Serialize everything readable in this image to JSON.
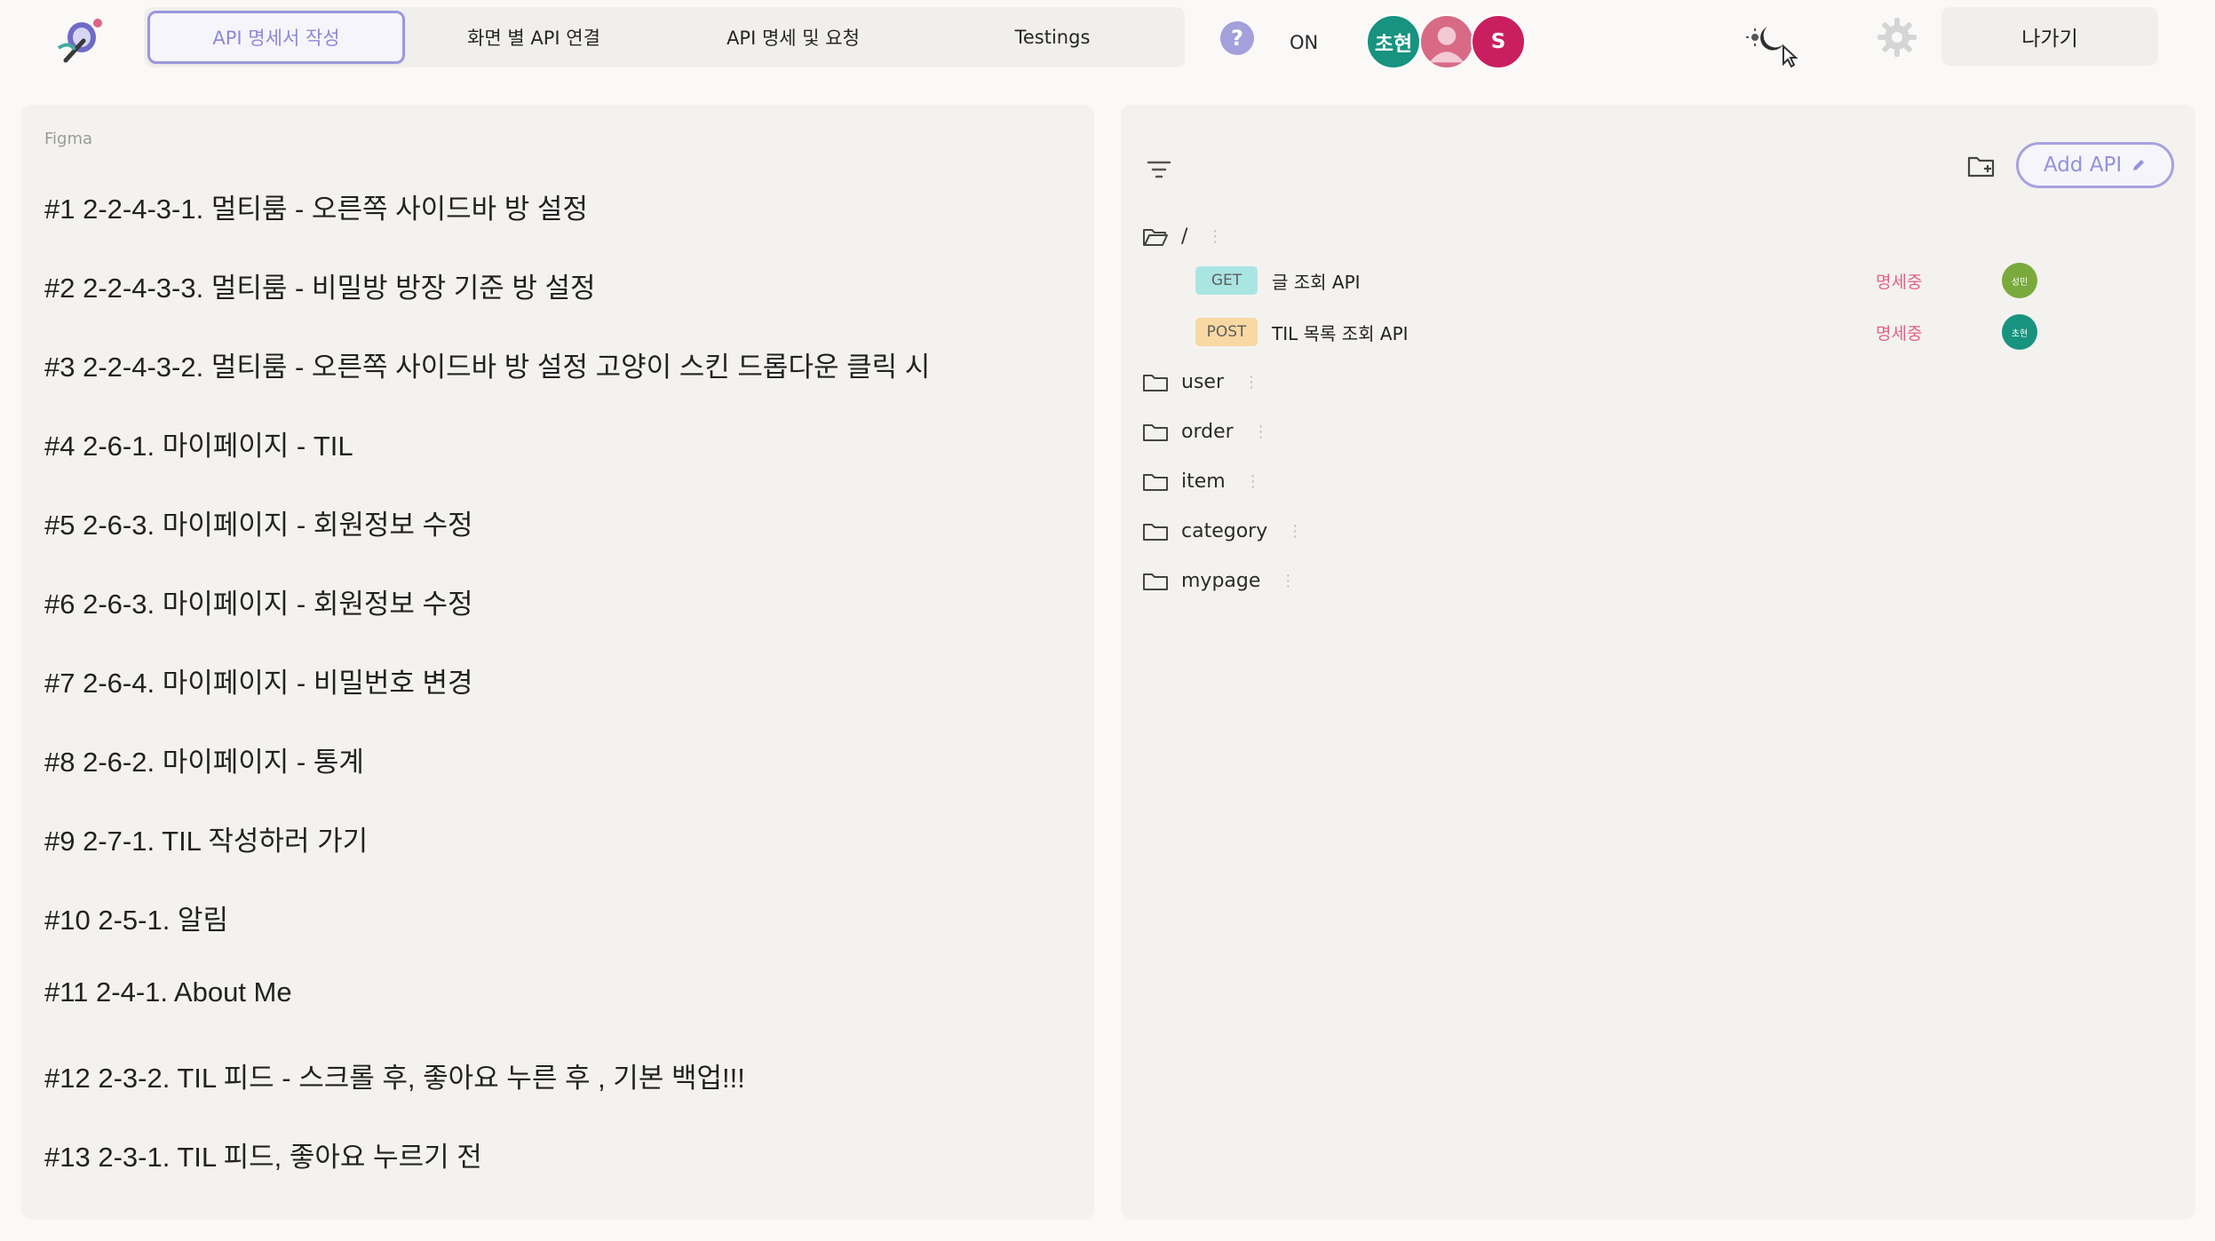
{
  "header": {
    "tabs": [
      {
        "label": "API 명세서 작성",
        "active": true
      },
      {
        "label": "화면 별 API 연결",
        "active": false
      },
      {
        "label": "API 명세 및 요청",
        "active": false
      },
      {
        "label": "Testings",
        "active": false
      }
    ],
    "help_symbol": "?",
    "status_label": "ON",
    "avatars": [
      {
        "label": "초현",
        "color": "#17937f"
      },
      {
        "label": "",
        "color": "#d86a86",
        "icon": "user-silhouette-icon"
      },
      {
        "label": "S",
        "color": "#c91f61"
      }
    ],
    "exit_label": "나가기"
  },
  "left_panel": {
    "source_label": "Figma",
    "frames": [
      "#1 2-2-4-3-1. 멀티룸 - 오른쪽 사이드바 방 설정",
      "#2 2-2-4-3-3. 멀티룸 - 비밀방 방장 기준 방 설정",
      "#3 2-2-4-3-2. 멀티룸 - 오른쪽 사이드바 방 설정 고양이 스킨 드롭다운 클릭 시",
      "#4 2-6-1. 마이페이지 - TIL",
      "#5 2-6-3. 마이페이지 - 회원정보 수정",
      "#6 2-6-3. 마이페이지 - 회원정보 수정",
      "#7 2-6-4. 마이페이지 - 비밀번호 변경",
      "#8 2-6-2. 마이페이지 - 통계",
      "#9 2-7-1. TIL 작성하러 가기",
      "#10 2-5-1. 알림",
      "#11 2-4-1. About Me",
      "#12 2-3-2. TIL 피드 - 스크롤 후, 좋아요 누른 후 , 기본 백업!!!",
      "#13 2-3-1. TIL 피드, 좋아요 누르기 전"
    ]
  },
  "right_panel": {
    "add_api_label": "Add API",
    "root_folder": "/",
    "apis": [
      {
        "method": "GET",
        "name": "글 조회 API",
        "status": "명세중",
        "owner": "성민",
        "owner_color": "#7aaa3c"
      },
      {
        "method": "POST",
        "name": "TIL 목록 조회 API",
        "status": "명세중",
        "owner": "초현",
        "owner_color": "#17937f"
      }
    ],
    "folders": [
      "user",
      "order",
      "item",
      "category",
      "mypage"
    ],
    "colors": {
      "accent": "#9c97de",
      "get_badge": "#a9e5e3",
      "post_badge": "#f8d9a3",
      "status_text": "#e0628a"
    }
  }
}
